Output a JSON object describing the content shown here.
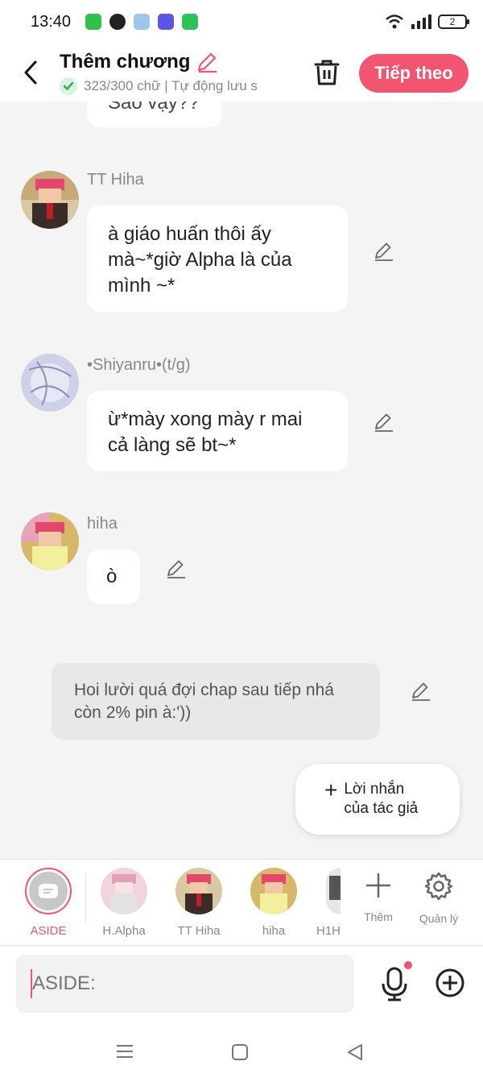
{
  "status": {
    "time": "13:40",
    "battery": "2"
  },
  "header": {
    "title": "Thêm chương",
    "subtitle": "323/300 chữ | Tự động lưu s",
    "next_label": "Tiếp theo"
  },
  "messages": {
    "partial_text": "Sao vậy??",
    "m1": {
      "name": "TT Hiha",
      "line1": "à giáo huấn thôi ấy",
      "line2": "mà~*giờ Alpha là của",
      "line3": "mình ~*"
    },
    "m2": {
      "name": "•Shiyanru•(t/g)",
      "line1": "ừ*mày xong mày r mai",
      "line2": "cả làng sẽ bt~*"
    },
    "m3": {
      "name": "hiha",
      "text": "ò"
    },
    "narration": {
      "line1": "Hoi lười quá đợi chap sau tiếp nhá",
      "line2": "còn 2% pin à:'))"
    }
  },
  "author_note": {
    "line1": "Lời nhắn",
    "line2": "của tác giả"
  },
  "characters": [
    {
      "label": "ASIDE"
    },
    {
      "label": "H.Alpha"
    },
    {
      "label": "TT Hiha"
    },
    {
      "label": "hiha"
    },
    {
      "label": "H1H"
    }
  ],
  "tools": {
    "add_label": "Thêm",
    "manage_label": "Quản lý"
  },
  "input": {
    "placeholder": "ASIDE:"
  },
  "colors": {
    "accent": "#f2556f",
    "bubble": "#ffffff",
    "background": "#f4f4f4"
  }
}
